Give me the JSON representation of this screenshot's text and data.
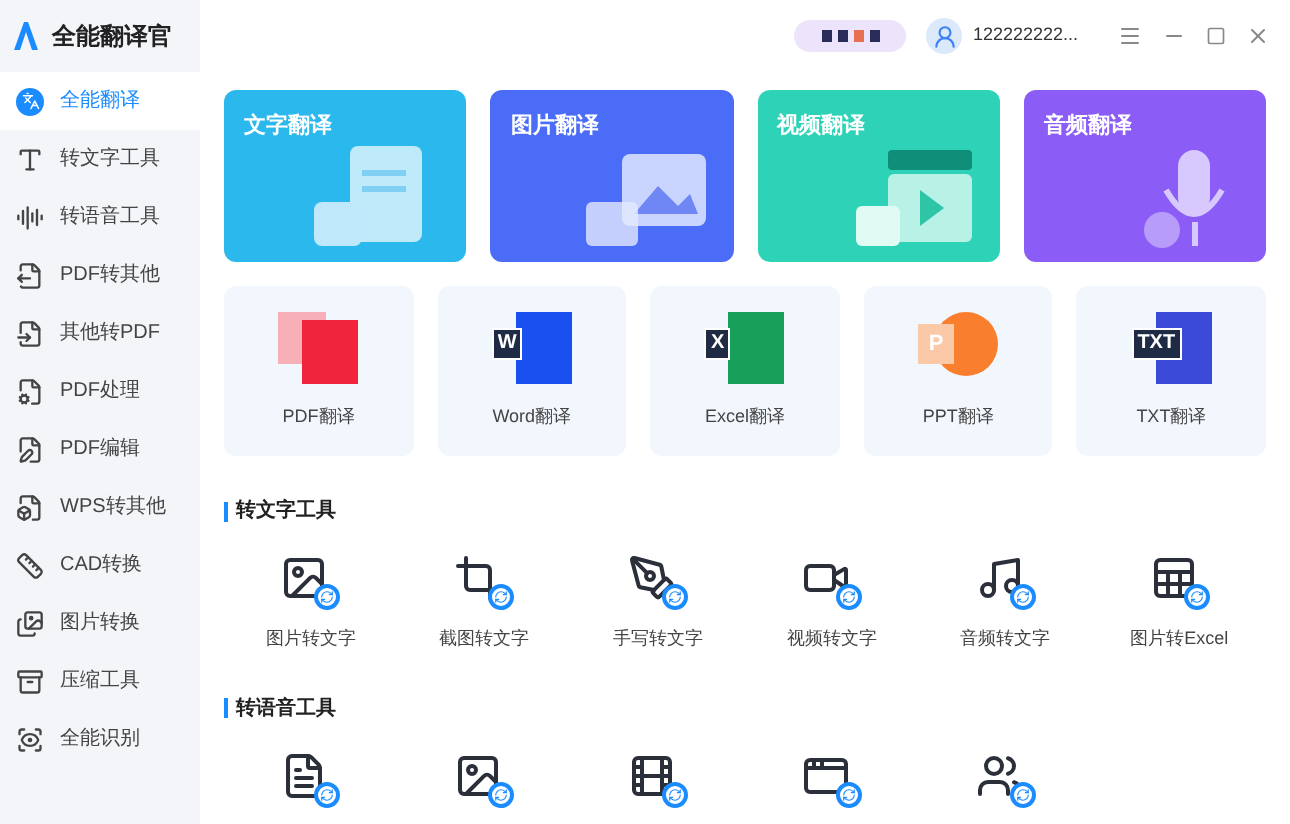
{
  "app": {
    "title": "全能翻译官"
  },
  "user": {
    "name": "122222222..."
  },
  "sidebar": {
    "items": [
      {
        "label": "全能翻译",
        "selected": true
      },
      {
        "label": "转文字工具",
        "selected": false
      },
      {
        "label": "转语音工具",
        "selected": false
      },
      {
        "label": "PDF转其他",
        "selected": false
      },
      {
        "label": "其他转PDF",
        "selected": false
      },
      {
        "label": "PDF处理",
        "selected": false
      },
      {
        "label": "PDF编辑",
        "selected": false
      },
      {
        "label": "WPS转其他",
        "selected": false
      },
      {
        "label": "CAD转换",
        "selected": false
      },
      {
        "label": "图片转换",
        "selected": false
      },
      {
        "label": "压缩工具",
        "selected": false
      },
      {
        "label": "全能识别",
        "selected": false
      }
    ]
  },
  "feature_cards": [
    {
      "label": "文字翻译",
      "kind": "text",
      "color": "#2bb8ec"
    },
    {
      "label": "图片翻译",
      "kind": "image",
      "color": "#4a6cf7"
    },
    {
      "label": "视频翻译",
      "kind": "video",
      "color": "#2ed3b7"
    },
    {
      "label": "音频翻译",
      "kind": "audio",
      "color": "#8b5cf6"
    }
  ],
  "doc_cards": [
    {
      "label": "PDF翻译",
      "kind": "pdf",
      "color": "#f0243c"
    },
    {
      "label": "Word翻译",
      "kind": "word",
      "mark": "W",
      "color": "#1a4ff0"
    },
    {
      "label": "Excel翻译",
      "kind": "excel",
      "mark": "X",
      "color": "#16a05a"
    },
    {
      "label": "PPT翻译",
      "kind": "ppt",
      "mark": "P",
      "color": "#f97f2e"
    },
    {
      "label": "TXT翻译",
      "kind": "txt",
      "mark": "TXT",
      "color": "#3b4ad8"
    }
  ],
  "sections": [
    {
      "title": "转文字工具",
      "tools": [
        {
          "kind": "labeled",
          "label": "图片转文字"
        },
        {
          "kind": "labeled",
          "label": "截图转文字"
        },
        {
          "kind": "labeled",
          "label": "手写转文字"
        },
        {
          "kind": "labeled",
          "label": "视频转文字"
        },
        {
          "kind": "labeled",
          "label": "音频转文字"
        },
        {
          "kind": "labeled",
          "label": "图片转Excel"
        }
      ]
    },
    {
      "title": "转语音工具",
      "tools": [
        {
          "kind": "icon"
        },
        {
          "kind": "icon"
        },
        {
          "kind": "icon"
        },
        {
          "kind": "icon"
        },
        {
          "kind": "icon"
        }
      ]
    }
  ]
}
